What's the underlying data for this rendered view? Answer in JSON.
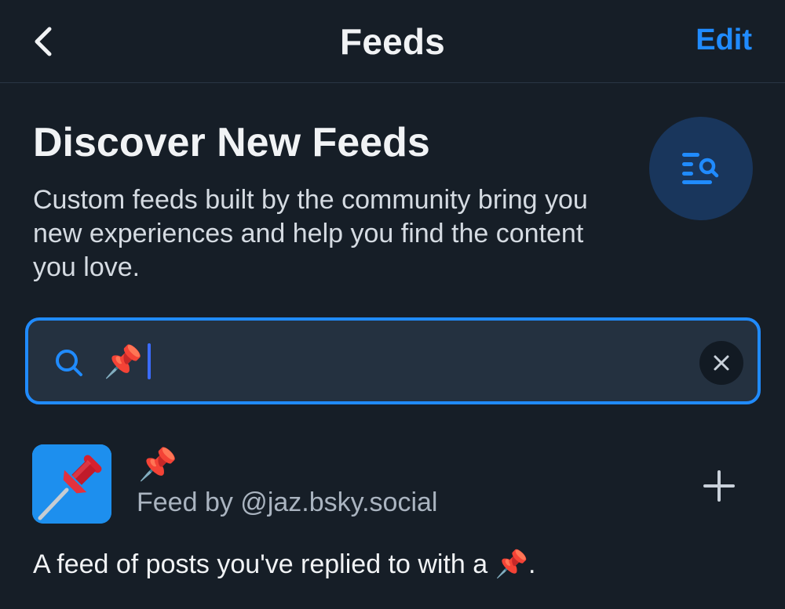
{
  "header": {
    "title": "Feeds",
    "edit_label": "Edit"
  },
  "discover": {
    "title": "Discover New Feeds",
    "description": "Custom feeds built by the community bring you new experiences and help you find the content you love.",
    "icon": "list-search-icon"
  },
  "search": {
    "value": "📌",
    "placeholder": ""
  },
  "feed": {
    "name": "📌",
    "author": "Feed by @jaz.bsky.social",
    "description": "A feed of posts you've replied to with a 📌."
  },
  "colors": {
    "background": "#161e27",
    "accent": "#208bfe",
    "search_bg": "#243140",
    "icon_circle": "#19365c",
    "muted_text": "#aab4c0"
  }
}
